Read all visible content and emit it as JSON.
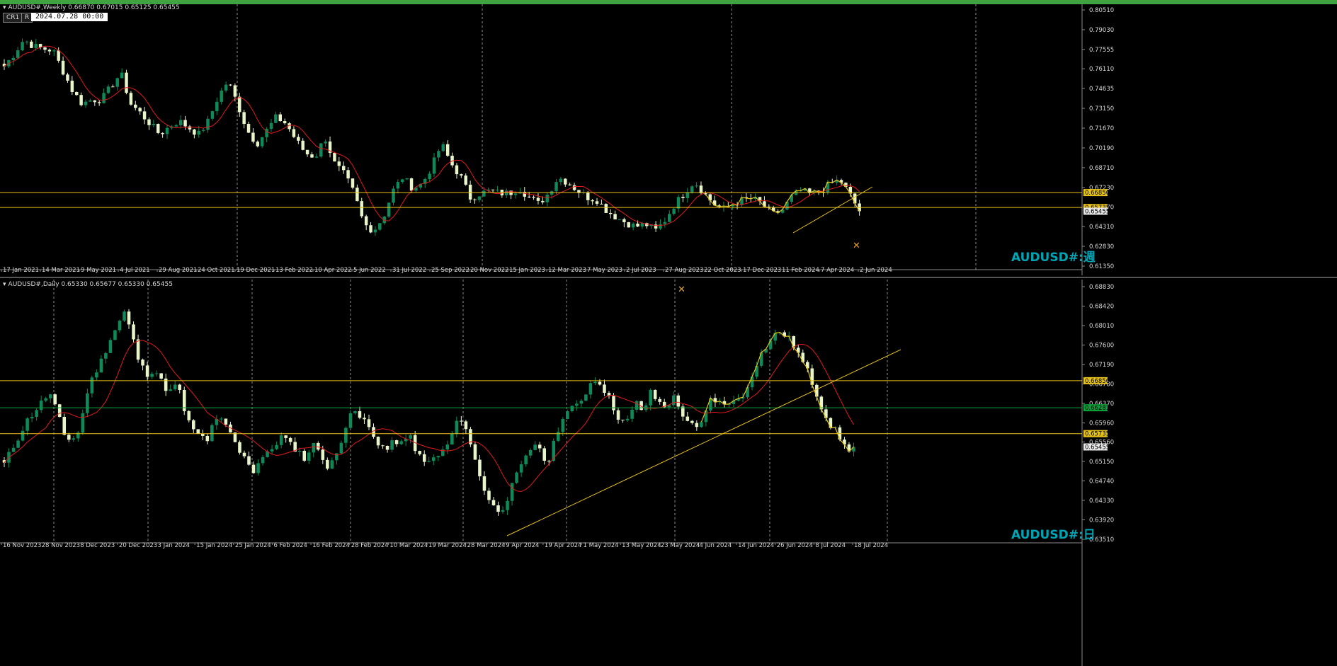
{
  "colors": {
    "background": "#000000",
    "bull_candle": "#0e8a5a",
    "bear_candle": "#e8f5c8",
    "ma_line": "#e01a1a",
    "level_line": "#e6c21a",
    "trend_line": "#e6c21a",
    "axis_text": "#d9d9d9",
    "grid_line": "#b0b0b0",
    "green_level": "#0aa03a",
    "watermark": "#00a5b5"
  },
  "toolbar": {
    "cr_label": "CR1",
    "r_label": "R",
    "datetime": "2024.07.28 00:00"
  },
  "chart_data": [
    {
      "type": "candlestick",
      "header": "AUDUSD#,Weekly  0.66870 0.67015 0.65125 0.65455",
      "watermark": "AUDUSD#:週",
      "x_tick_labels": [
        "17 Jan 2021",
        "14 Mar 2021",
        "9 May 2021",
        "4 Jul 2021",
        "29 Aug 2021",
        "24 Oct 2021",
        "19 Dec 2021",
        "13 Feb 2022",
        "10 Apr 2022",
        "5 Jun 2022",
        "31 Jul 2022",
        "25 Sep 2022",
        "20 Nov 2022",
        "15 Jan 2023",
        "12 Mar 2023",
        "7 May 2023",
        "2 Jul 2023",
        "27 Aug 2023",
        "22 Oct 2023",
        "17 Dec 2023",
        "11 Feb 2024",
        "7 Apr 2024",
        "2 Jun 2024"
      ],
      "y_tick_labels": [
        "0.80510",
        "0.79030",
        "0.77555",
        "0.76110",
        "0.74635",
        "0.73150",
        "0.71670",
        "0.70190",
        "0.68710",
        "0.67230",
        "0.65770",
        "0.64310",
        "0.62830",
        "0.61350"
      ],
      "ylim": [
        0.6135,
        0.8051
      ],
      "levels": [
        0.6685,
        0.65735
      ],
      "level_labels": [
        "0.66850",
        "0.65735"
      ],
      "last_price_label": "0.65455",
      "close_path": [
        0.763,
        0.772,
        0.783,
        0.778,
        0.776,
        0.775,
        0.76,
        0.745,
        0.735,
        0.738,
        0.738,
        0.748,
        0.758,
        0.735,
        0.728,
        0.72,
        0.712,
        0.718,
        0.722,
        0.717,
        0.712,
        0.722,
        0.74,
        0.752,
        0.735,
        0.715,
        0.705,
        0.715,
        0.725,
        0.72,
        0.708,
        0.698,
        0.695,
        0.71,
        0.69,
        0.682,
        0.668,
        0.645,
        0.64,
        0.65,
        0.67,
        0.68,
        0.672,
        0.675,
        0.688,
        0.705,
        0.69,
        0.68,
        0.664,
        0.668,
        0.67,
        0.668,
        0.668,
        0.672,
        0.665,
        0.66,
        0.668,
        0.68,
        0.676,
        0.67,
        0.665,
        0.663,
        0.655,
        0.65,
        0.646,
        0.643,
        0.645,
        0.64,
        0.648,
        0.66,
        0.668,
        0.677,
        0.668,
        0.66,
        0.656,
        0.66,
        0.663,
        0.664,
        0.66,
        0.652,
        0.655,
        0.665,
        0.67,
        0.667,
        0.67,
        0.675,
        0.678,
        0.667,
        0.65455
      ]
    },
    {
      "type": "candlestick",
      "header": "AUDUSD#,Daily  0.65330 0.65677 0.65330 0.65455",
      "watermark": "AUDUSD#:日",
      "x_tick_labels": [
        "16 Nov 2023",
        "28 Nov 2023",
        "8 Dec 2023",
        "20 Dec 2023",
        "3 Jan 2024",
        "15 Jan 2024",
        "25 Jan 2024",
        "6 Feb 2024",
        "16 Feb 2024",
        "28 Feb 2024",
        "10 Mar 2024",
        "19 Mar 2024",
        "28 Mar 2024",
        "9 Apr 2024",
        "19 Apr 2024",
        "1 May 2024",
        "13 May 2024",
        "23 May 2024",
        "4 Jun 2024",
        "14 Jun 2024",
        "26 Jun 2024",
        "8 Jul 2024",
        "18 Jul 2024"
      ],
      "y_tick_labels": [
        "0.68830",
        "0.68420",
        "0.68010",
        "0.67600",
        "0.67190",
        "0.66780",
        "0.66370",
        "0.65960",
        "0.65560",
        "0.65150",
        "0.64740",
        "0.64330",
        "0.63920",
        "0.63510"
      ],
      "ylim": [
        0.6351,
        0.6883
      ],
      "levels": [
        0.6685,
        0.65735
      ],
      "level_labels": [
        "0.66850",
        "0.65735"
      ],
      "green_level": 0.6628,
      "green_level_label": "0.66281",
      "last_price_label": "0.65455",
      "close_path": [
        0.651,
        0.654,
        0.657,
        0.66,
        0.662,
        0.664,
        0.666,
        0.662,
        0.657,
        0.656,
        0.658,
        0.666,
        0.67,
        0.673,
        0.677,
        0.68,
        0.683,
        0.678,
        0.672,
        0.67,
        0.671,
        0.668,
        0.666,
        0.668,
        0.662,
        0.658,
        0.657,
        0.656,
        0.66,
        0.66,
        0.658,
        0.654,
        0.653,
        0.649,
        0.652,
        0.653,
        0.655,
        0.657,
        0.655,
        0.654,
        0.652,
        0.655,
        0.654,
        0.65,
        0.652,
        0.657,
        0.662,
        0.661,
        0.66,
        0.657,
        0.655,
        0.654,
        0.656,
        0.655,
        0.657,
        0.653,
        0.651,
        0.652,
        0.653,
        0.655,
        0.659,
        0.661,
        0.655,
        0.65,
        0.645,
        0.642,
        0.641,
        0.644,
        0.648,
        0.651,
        0.654,
        0.656,
        0.65,
        0.655,
        0.66,
        0.662,
        0.663,
        0.665,
        0.668,
        0.669,
        0.666,
        0.663,
        0.66,
        0.66,
        0.664,
        0.662,
        0.666,
        0.664,
        0.663,
        0.665,
        0.662,
        0.66,
        0.658,
        0.66,
        0.665,
        0.664,
        0.663,
        0.665,
        0.664,
        0.668,
        0.672,
        0.675,
        0.677,
        0.679,
        0.678,
        0.676,
        0.673,
        0.67,
        0.666,
        0.662,
        0.659,
        0.657,
        0.654,
        0.65455
      ]
    }
  ]
}
